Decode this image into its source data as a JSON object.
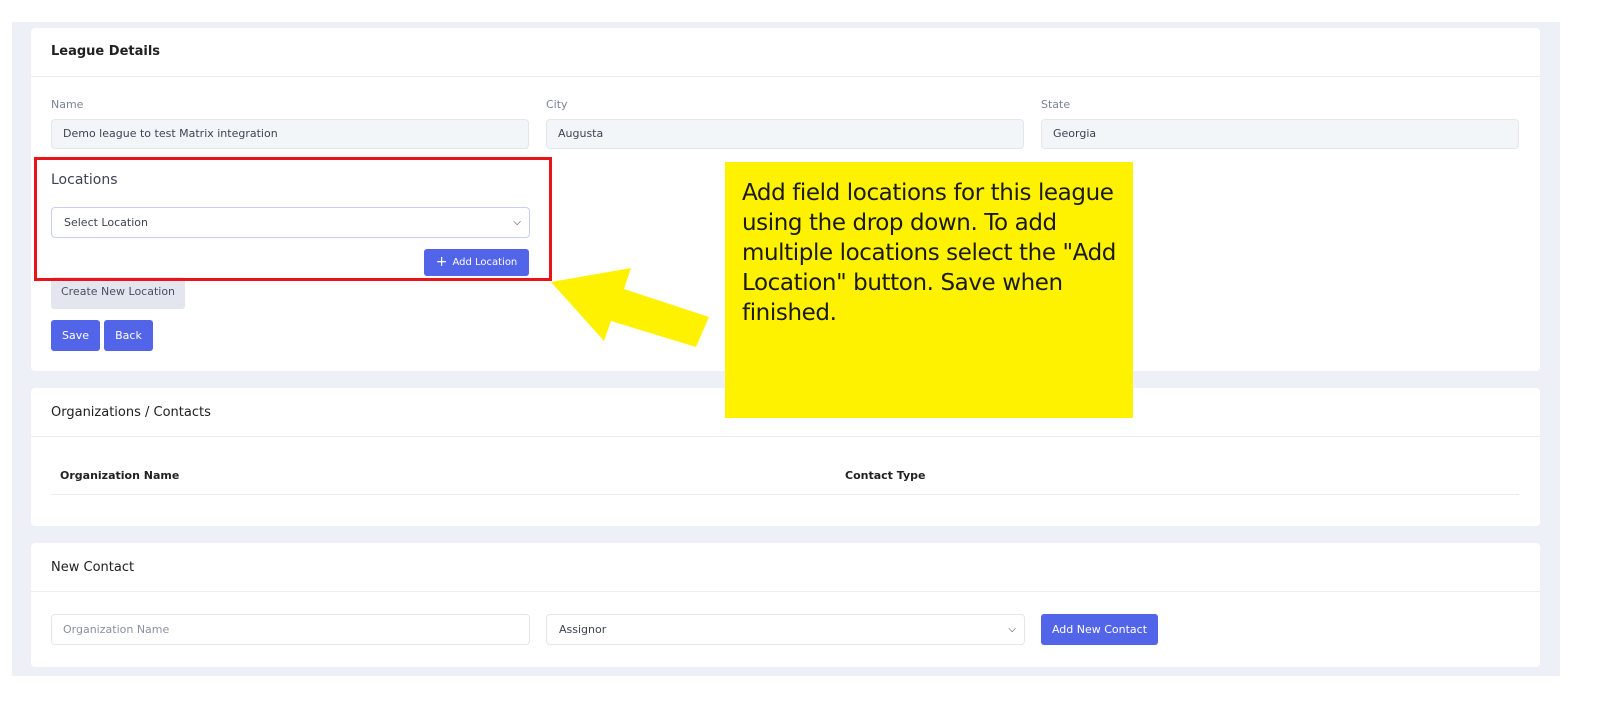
{
  "league_details": {
    "title": "League Details",
    "name_label": "Name",
    "name_value": "Demo league to test Matrix integration",
    "city_label": "City",
    "city_value": "Augusta",
    "state_label": "State",
    "state_value": "Georgia",
    "locations_label": "Locations",
    "location_select_value": "Select Location",
    "add_location_label": "Add Location",
    "create_new_location_label": "Create New Location",
    "save_label": "Save",
    "back_label": "Back"
  },
  "callout": {
    "text": "Add field locations for this league using the drop down. To add multiple locations select the \"Add Location\" button. Save when finished.",
    "highlight_color": "#e8141a",
    "note_color": "#fff200"
  },
  "organizations": {
    "title": "Organizations / Contacts",
    "columns": [
      "Organization Name",
      "Contact Type"
    ]
  },
  "new_contact": {
    "title": "New Contact",
    "org_placeholder": "Organization Name",
    "type_value": "Assignor",
    "add_button_label": "Add New Contact"
  },
  "colors": {
    "primary": "#5264e8",
    "page_bg": "#eef0f8",
    "muted_button": "#e4e6ef"
  }
}
